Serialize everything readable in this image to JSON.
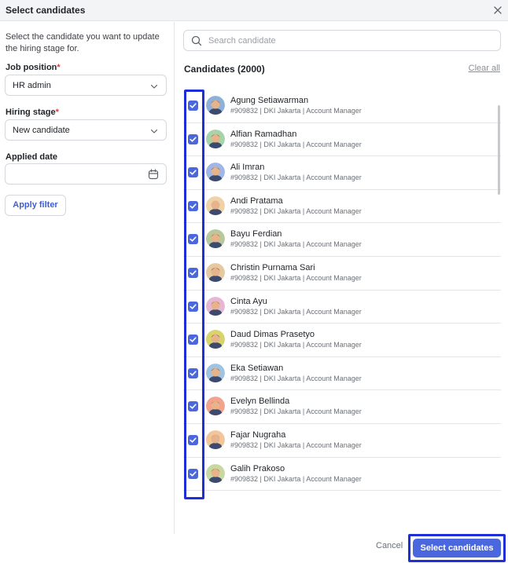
{
  "dialog": {
    "title": "Select candidates"
  },
  "filters": {
    "description": "Select the candidate you want to update the hiring stage for.",
    "job_position_label": "Job position",
    "job_position_value": "HR admin",
    "hiring_stage_label": "Hiring stage",
    "hiring_stage_value": "New candidate",
    "applied_date_label": "Applied date",
    "required_marker": "*",
    "apply_label": "Apply filter"
  },
  "search": {
    "placeholder": "Search candidate"
  },
  "candidates": {
    "heading": "Candidates (2000)",
    "clear_all": "Clear all",
    "items": [
      {
        "name": "Agung Setiawarman",
        "meta": "#909832 | DKI Jakarta | Account Manager",
        "checked": true
      },
      {
        "name": "Alfian Ramadhan",
        "meta": "#909832 | DKI Jakarta | Account Manager",
        "checked": true
      },
      {
        "name": "Ali Imran",
        "meta": "#909832 | DKI Jakarta | Account Manager",
        "checked": true
      },
      {
        "name": "Andi Pratama",
        "meta": "#909832 | DKI Jakarta | Account Manager",
        "checked": true
      },
      {
        "name": "Bayu Ferdian",
        "meta": "#909832 | DKI Jakarta | Account Manager",
        "checked": true
      },
      {
        "name": "Christin Purnama Sari",
        "meta": "#909832 | DKI Jakarta | Account Manager",
        "checked": true
      },
      {
        "name": "Cinta Ayu",
        "meta": "#909832 | DKI Jakarta | Account Manager",
        "checked": true
      },
      {
        "name": "Daud Dimas Prasetyo",
        "meta": "#909832 | DKI Jakarta | Account Manager",
        "checked": true
      },
      {
        "name": "Eka Setiawan",
        "meta": "#909832 | DKI Jakarta | Account Manager",
        "checked": true
      },
      {
        "name": "Evelyn Bellinda",
        "meta": "#909832 | DKI Jakarta | Account Manager",
        "checked": true
      },
      {
        "name": "Fajar Nugraha",
        "meta": "#909832 | DKI Jakarta | Account Manager",
        "checked": true
      },
      {
        "name": "Galih Prakoso",
        "meta": "#909832 | DKI Jakarta | Account Manager",
        "checked": true
      }
    ]
  },
  "footer": {
    "cancel_label": "Cancel",
    "submit_label": "Select candidates"
  },
  "colors": {
    "accent": "#4a67de",
    "highlight": "#1f2fd8",
    "required": "#e23b3b"
  },
  "icons": {
    "close": "close-icon",
    "chevron": "chevron-down-icon",
    "calendar": "calendar-icon",
    "search": "search-icon",
    "check": "check-icon",
    "avatar": "avatar"
  }
}
